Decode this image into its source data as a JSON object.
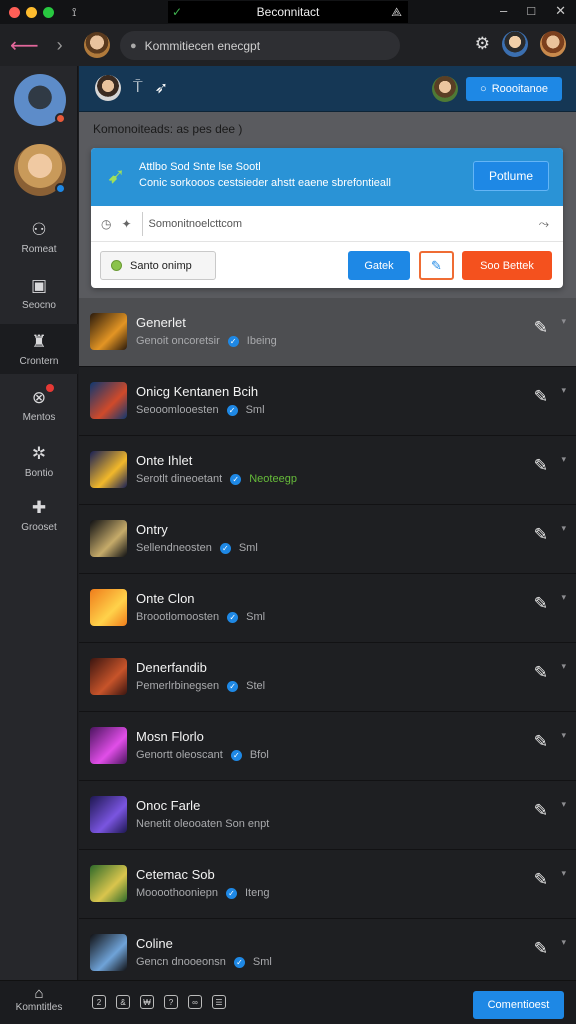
{
  "window": {
    "title": "Beconnitact",
    "controls": [
      "–",
      "□",
      "✕"
    ],
    "traffic_colors": [
      "#ff5f57",
      "#febc2e",
      "#28c840"
    ]
  },
  "browser": {
    "address": "Kommitiecen enecgpt",
    "back_icon": "back-arrow-icon",
    "forward_icon": "forward-arrow-icon"
  },
  "sidebar": {
    "items": [
      {
        "label": "Romeat",
        "icon": "gamepad-icon"
      },
      {
        "label": "Seocno",
        "icon": "bag-icon"
      },
      {
        "label": "Crontern",
        "icon": "castle-icon"
      },
      {
        "label": "Mentos",
        "icon": "target-icon",
        "badge": true
      },
      {
        "label": "Bontio",
        "icon": "settings-icon"
      },
      {
        "label": "Grooset",
        "icon": "puzzle-icon"
      }
    ]
  },
  "header": {
    "button_label": "Roooitanoe"
  },
  "panel": {
    "title": "Komonoiteads: as pes dee )",
    "notice_line1": "Attlbo Sod Snte lse Sootl",
    "notice_line2": "Conic sorkooos cestsieder ahstt eaene sbrefontieall",
    "notice_button": "Potlume",
    "url_text": "Somonitnoelcttcom",
    "status_label": "Santo onimp",
    "button_blue": "Gatek",
    "button_orange": "Soo Bettek"
  },
  "list": {
    "rows": [
      {
        "title": "Generlet",
        "sub": "Genoit oncoretsir",
        "tag": "Ibeing",
        "tag_green": false,
        "colors": [
          "#2a1a0c",
          "#e39524"
        ]
      },
      {
        "title": "Onicg Kentanen Bcih",
        "sub": "Seooomlooesten",
        "tag": "Sml",
        "tag_green": false,
        "colors": [
          "#0e3770",
          "#d04a2a"
        ]
      },
      {
        "title": "Onte Ihlet",
        "sub": "Serotlt dineoetant",
        "tag": "Neoteegp",
        "tag_green": true,
        "colors": [
          "#181f55",
          "#f1b82b"
        ]
      },
      {
        "title": "Ontry",
        "sub": "Sellendneosten",
        "tag": "Sml",
        "tag_green": false,
        "colors": [
          "#0f1013",
          "#c6ab6a"
        ]
      },
      {
        "title": "Onte Clon",
        "sub": "Broootlomoosten",
        "tag": "Sml",
        "tag_green": false,
        "colors": [
          "#ef7c1b",
          "#ffd24a"
        ]
      },
      {
        "title": "Denerfandib",
        "sub": "Pemerlrbinegsen",
        "tag": "Stel",
        "tag_green": false,
        "colors": [
          "#3b1510",
          "#c7542a"
        ]
      },
      {
        "title": "Mosn Florlo",
        "sub": "Genortt oleoscant",
        "tag": "Bfol",
        "tag_green": false,
        "colors": [
          "#4b145f",
          "#e14ee8"
        ]
      },
      {
        "title": "Onoc Farle",
        "sub": "Nenetit oleooaten Son enpt",
        "tag": "",
        "tag_green": false,
        "colors": [
          "#1d1750",
          "#7a55e0"
        ]
      },
      {
        "title": "Cetemac Sob",
        "sub": "Moooothooniepn",
        "tag": "Iteng",
        "tag_green": false,
        "colors": [
          "#2e6a2a",
          "#d9c54d"
        ]
      },
      {
        "title": "Coline",
        "sub": "Gencn dnooeonsn",
        "tag": "Sml",
        "tag_green": false,
        "colors": [
          "#111114",
          "#6fa3d8"
        ]
      }
    ]
  },
  "bottom": {
    "home_label": "Komntitles",
    "cta_label": "Comentioest",
    "tools": [
      "2",
      "&",
      "₩",
      "?",
      "∞",
      "☰"
    ]
  }
}
